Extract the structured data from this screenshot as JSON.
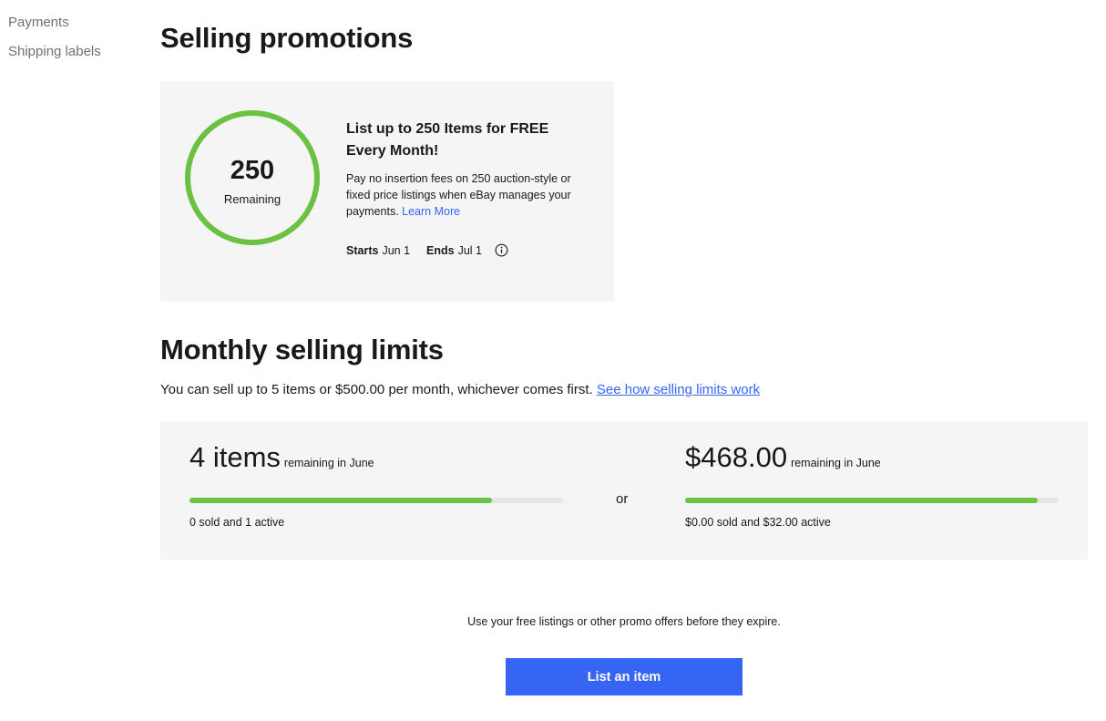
{
  "sidebar": {
    "items": [
      {
        "label": "Payments"
      },
      {
        "label": "Shipping labels"
      }
    ]
  },
  "promotions": {
    "heading": "Selling promotions",
    "count": "250",
    "count_label": "Remaining",
    "remaining_fraction": 1.0,
    "title": "List up to 250 Items for FREE Every Month!",
    "description": "Pay no insertion fees on 250 auction-style or fixed price listings when eBay manages your payments.",
    "learn_more": "Learn More",
    "starts_label": "Starts",
    "starts_value": "Jun 1",
    "ends_label": "Ends",
    "ends_value": "Jul 1",
    "info_icon": "info-icon"
  },
  "limits": {
    "heading": "Monthly selling limits",
    "description": "You can sell up to 5 items or $500.00 per month, whichever comes first.",
    "link": "See how selling limits work",
    "or_label": "or",
    "items": {
      "value": "4 items",
      "suffix": "remaining in June",
      "progress_fraction": 0.81,
      "detail": "0 sold and 1 active"
    },
    "amount": {
      "value": "$468.00",
      "suffix": "remaining in June",
      "progress_fraction": 0.944,
      "detail": "$0.00 sold and $32.00 active"
    }
  },
  "footer": {
    "note": "Use your free listings or other promo offers before they expire.",
    "button_label": "List an item"
  },
  "colors": {
    "accent_blue": "#3665f3",
    "progress_green": "#6ac142",
    "card_bg": "#f5f5f5"
  }
}
